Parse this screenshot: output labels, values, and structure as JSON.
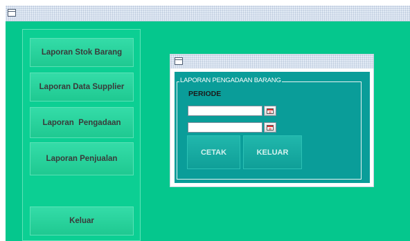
{
  "main_window": {
    "title": ""
  },
  "sidebar": {
    "items": [
      {
        "label": "Laporan Stok Barang"
      },
      {
        "label": "Laporan Data Supplier"
      },
      {
        "label": "Laporan  Pengadaan"
      },
      {
        "label": "Laporan Penjualan"
      }
    ],
    "exit_label": "Keluar"
  },
  "dialog": {
    "title": "",
    "group_title": "LAPORAN PENGADAAN BARANG",
    "periode_label": "PERIODE",
    "date_from": {
      "value": "",
      "placeholder": ""
    },
    "date_to": {
      "value": "",
      "placeholder": ""
    },
    "print_label": "CETAK",
    "close_label": "KELUAR"
  },
  "icons": {
    "window": "window-icon",
    "calendar": "calendar-icon"
  },
  "colors": {
    "background": "#05c78d",
    "panel_bg": "#0a9d99",
    "titlebar": "#e4ecf6"
  }
}
